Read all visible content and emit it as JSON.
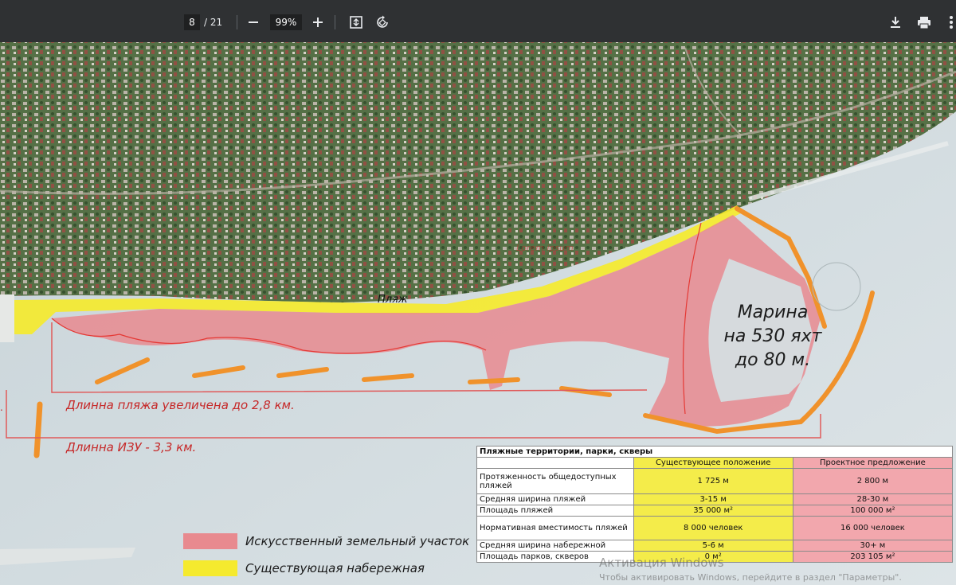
{
  "toolbar": {
    "page_current": "8",
    "page_total": "/ 21",
    "zoom": "99%",
    "icons": [
      "minus-icon",
      "plus-icon",
      "fit-page-icon",
      "rotate-icon",
      "download-icon",
      "print-icon",
      "more-vert-icon"
    ]
  },
  "map": {
    "marina_label": [
      "Марина",
      "на 530 яхт",
      "до 80 м."
    ],
    "beach_label": "Пляж",
    "beach_length_label": "Длинна пляжа увеличена до 2,8 км.",
    "izu_length_label": "Длинна ИЗУ - 3,3 км.",
    "faint_label": "Lorem ipsum",
    "edge_label": "."
  },
  "legend": [
    {
      "label": "Искусственный земельный участок",
      "color": "#e88a8f"
    },
    {
      "label": "Существующая набережная",
      "color": "#f5ea2e"
    }
  ],
  "table": {
    "title": "Пляжные территории, парки, скверы",
    "col_existing": "Существующее положение",
    "col_project": "Проектное предложение",
    "rows": [
      {
        "label": "Протяженность общедоступных пляжей",
        "existing": "1 725 м",
        "project": "2 800 м"
      },
      {
        "label": "Средняя ширина пляжей",
        "existing": "3-15 м",
        "project": "28-30 м"
      },
      {
        "label": "Площадь пляжей",
        "existing": "35 000 м²",
        "project": "100 000 м²"
      },
      {
        "label": "Нормативная вместимость пляжей",
        "existing": "8 000 человек",
        "project": "16 000 человек"
      },
      {
        "label": "Средняя ширина набережной",
        "existing": "5-6 м",
        "project": "30+ м"
      },
      {
        "label": "Площадь парков, скверов",
        "existing": "0 м²",
        "project": "203 105 м²"
      }
    ]
  },
  "watermark": {
    "line1": "Активация Windows",
    "line2": "Чтобы активировать Windows, перейдите в раздел \"Параметры\"."
  },
  "colors": {
    "toolbar_bg": "#2f3133",
    "artificial_land": "#e88a8f",
    "existing_embankment": "#f5ea2e",
    "breakwater": "#f0922b",
    "length_lines": "#e05a5a"
  }
}
